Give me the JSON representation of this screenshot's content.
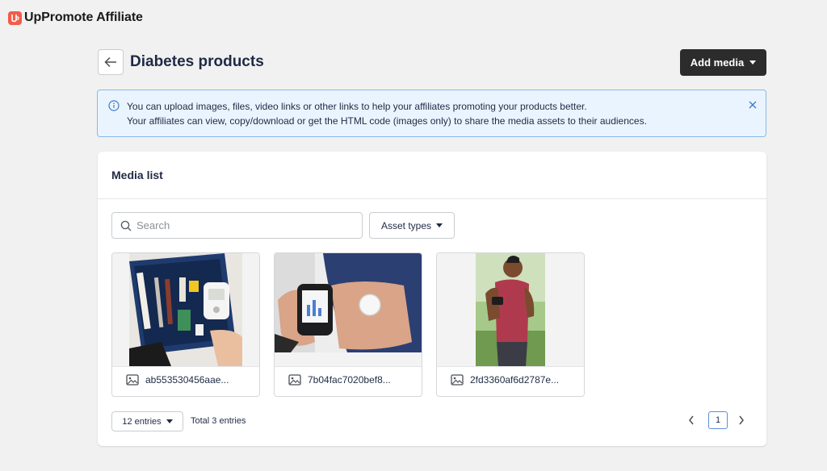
{
  "app": {
    "name": "UpPromote Affiliate",
    "logo_letter": "Up",
    "brand_color": "#f25c4a"
  },
  "header": {
    "title": "Diabetes products",
    "add_media_label": "Add media",
    "back_icon": "arrow-left-icon"
  },
  "banner": {
    "line1": "You can upload images, files, video links or other links to help your affiliates promoting your products better.",
    "line2": "Your affiliates can view, copy/download or get the HTML code (images only) to share the media assets to their audiences.",
    "accent": "#8ab8e6"
  },
  "media_list": {
    "title": "Media list",
    "search": {
      "placeholder": "Search",
      "value": ""
    },
    "asset_types_label": "Asset types",
    "items": [
      {
        "name": "ab553530456aae...",
        "type_icon": "image-icon"
      },
      {
        "name": "7b04fac7020bef8...",
        "type_icon": "image-icon"
      },
      {
        "name": "2fd3360af6d2787e...",
        "type_icon": "image-icon"
      }
    ],
    "entries_label": "12 entries",
    "total_label": "Total 3 entries",
    "current_page": "1"
  }
}
